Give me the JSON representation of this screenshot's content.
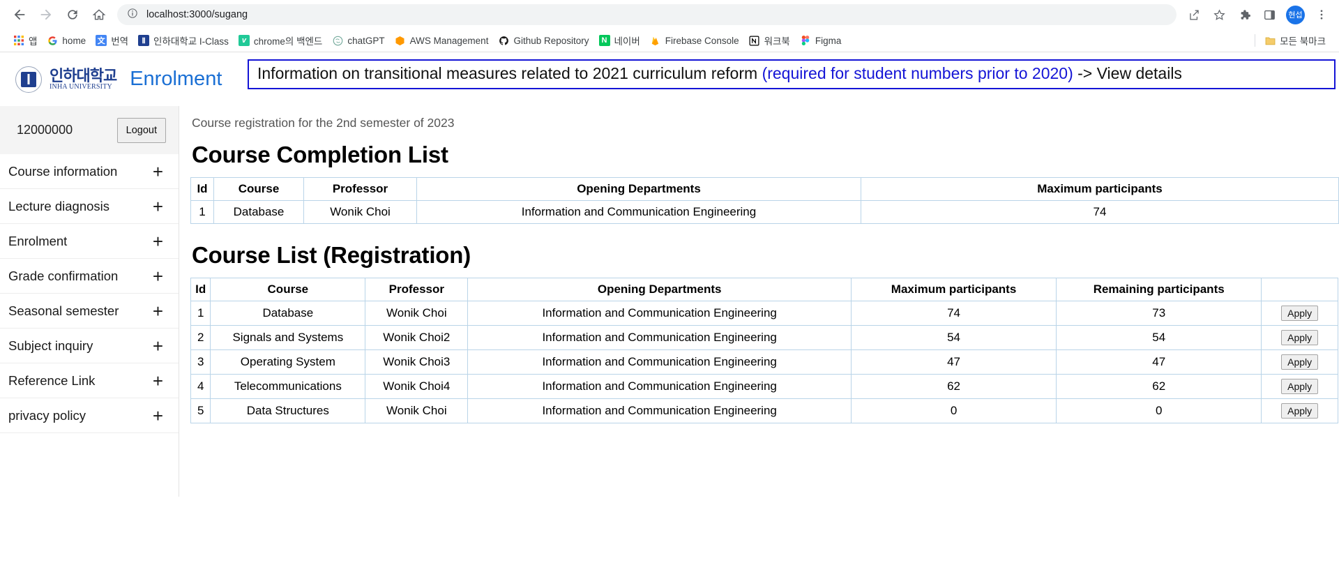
{
  "browser": {
    "url": "localhost:3000/sugang",
    "nav": {
      "back": "back-arrow",
      "forward": "forward-arrow",
      "reload": "reload",
      "home": "home"
    },
    "toolbar_icons": [
      "share-icon",
      "bookmark-star-icon",
      "extensions-puzzle-icon",
      "side-panel-icon",
      "profile-avatar",
      "chrome-menu-icon"
    ],
    "avatar_label": "현섭",
    "bookmarks": [
      {
        "label": "앱",
        "favicon": "apps-grid-icon",
        "color": "#4285f4"
      },
      {
        "label": "home",
        "favicon": "google-g-icon",
        "color": "#ea4335"
      },
      {
        "label": "번역",
        "favicon": "google-translate-icon",
        "color": "#4285f4"
      },
      {
        "label": "인하대학교 I-Class",
        "favicon": "inha-iclass-icon",
        "color": "#1f3f8f"
      },
      {
        "label": "chrome의 백엔드",
        "favicon": "velog-icon",
        "color": "#20c997"
      },
      {
        "label": "chatGPT",
        "favicon": "chatgpt-icon",
        "color": "#74aa9c"
      },
      {
        "label": "AWS Management",
        "favicon": "aws-icon",
        "color": "#ff9900"
      },
      {
        "label": "Github Repository",
        "favicon": "github-icon",
        "color": "#181717"
      },
      {
        "label": "네이버",
        "favicon": "naver-icon",
        "color": "#03c75a"
      },
      {
        "label": "Firebase Console",
        "favicon": "firebase-icon",
        "color": "#ffa000"
      },
      {
        "label": "워크북",
        "favicon": "notion-icon",
        "color": "#000000"
      },
      {
        "label": "Figma",
        "favicon": "figma-icon",
        "color": "#f24e1e"
      }
    ],
    "all_bookmarks_label": "모든 북마크",
    "all_bookmarks_icon": "folder-icon"
  },
  "header": {
    "logo_ko": "인하대학교",
    "logo_en": "INHA UNIVERSITY",
    "app_title": "Enrolment",
    "notice_part1": "Information on transitional measures related to 2021 curriculum reform ",
    "notice_part2": "(required for student numbers prior to 2020)",
    "notice_part3": " -> View details"
  },
  "sidebar": {
    "student_id": "12000000",
    "logout_label": "Logout",
    "items": [
      {
        "label": "Course information",
        "expander": "+"
      },
      {
        "label": "Lecture diagnosis",
        "expander": "+"
      },
      {
        "label": "Enrolment",
        "expander": "+"
      },
      {
        "label": "Grade confirmation",
        "expander": "+"
      },
      {
        "label": "Seasonal semester",
        "expander": "+"
      },
      {
        "label": "Subject inquiry",
        "expander": "+"
      },
      {
        "label": "Reference Link",
        "expander": "+"
      },
      {
        "label": "privacy policy",
        "expander": "+"
      }
    ]
  },
  "main": {
    "semester_line": "Course registration for the 2nd semester of 2023",
    "completion": {
      "title": "Course Completion List",
      "columns": [
        "Id",
        "Course",
        "Professor",
        "Opening Departments",
        "Maximum participants"
      ],
      "rows": [
        [
          "1",
          "Database",
          "Wonik Choi",
          "Information and Communication Engineering",
          "74"
        ]
      ]
    },
    "registration": {
      "title": "Course List (Registration)",
      "columns": [
        "Id",
        "Course",
        "Professor",
        "Opening Departments",
        "Maximum participants",
        "Remaining participants",
        ""
      ],
      "apply_label": "Apply",
      "rows": [
        [
          "1",
          "Database",
          "Wonik Choi",
          "Information and Communication Engineering",
          "74",
          "73"
        ],
        [
          "2",
          "Signals and Systems",
          "Wonik Choi2",
          "Information and Communication Engineering",
          "54",
          "54"
        ],
        [
          "3",
          "Operating System",
          "Wonik Choi3",
          "Information and Communication Engineering",
          "47",
          "47"
        ],
        [
          "4",
          "Telecommunications",
          "Wonik Choi4",
          "Information and Communication Engineering",
          "62",
          "62"
        ],
        [
          "5",
          "Data Structures",
          "Wonik Choi",
          "Information and Communication Engineering",
          "0",
          "0"
        ]
      ]
    }
  },
  "colors": {
    "brand_blue": "#1f3f8f",
    "title_blue": "#1a6fd4",
    "notice_border": "#1414d6",
    "table_border": "#b9d4e8"
  }
}
